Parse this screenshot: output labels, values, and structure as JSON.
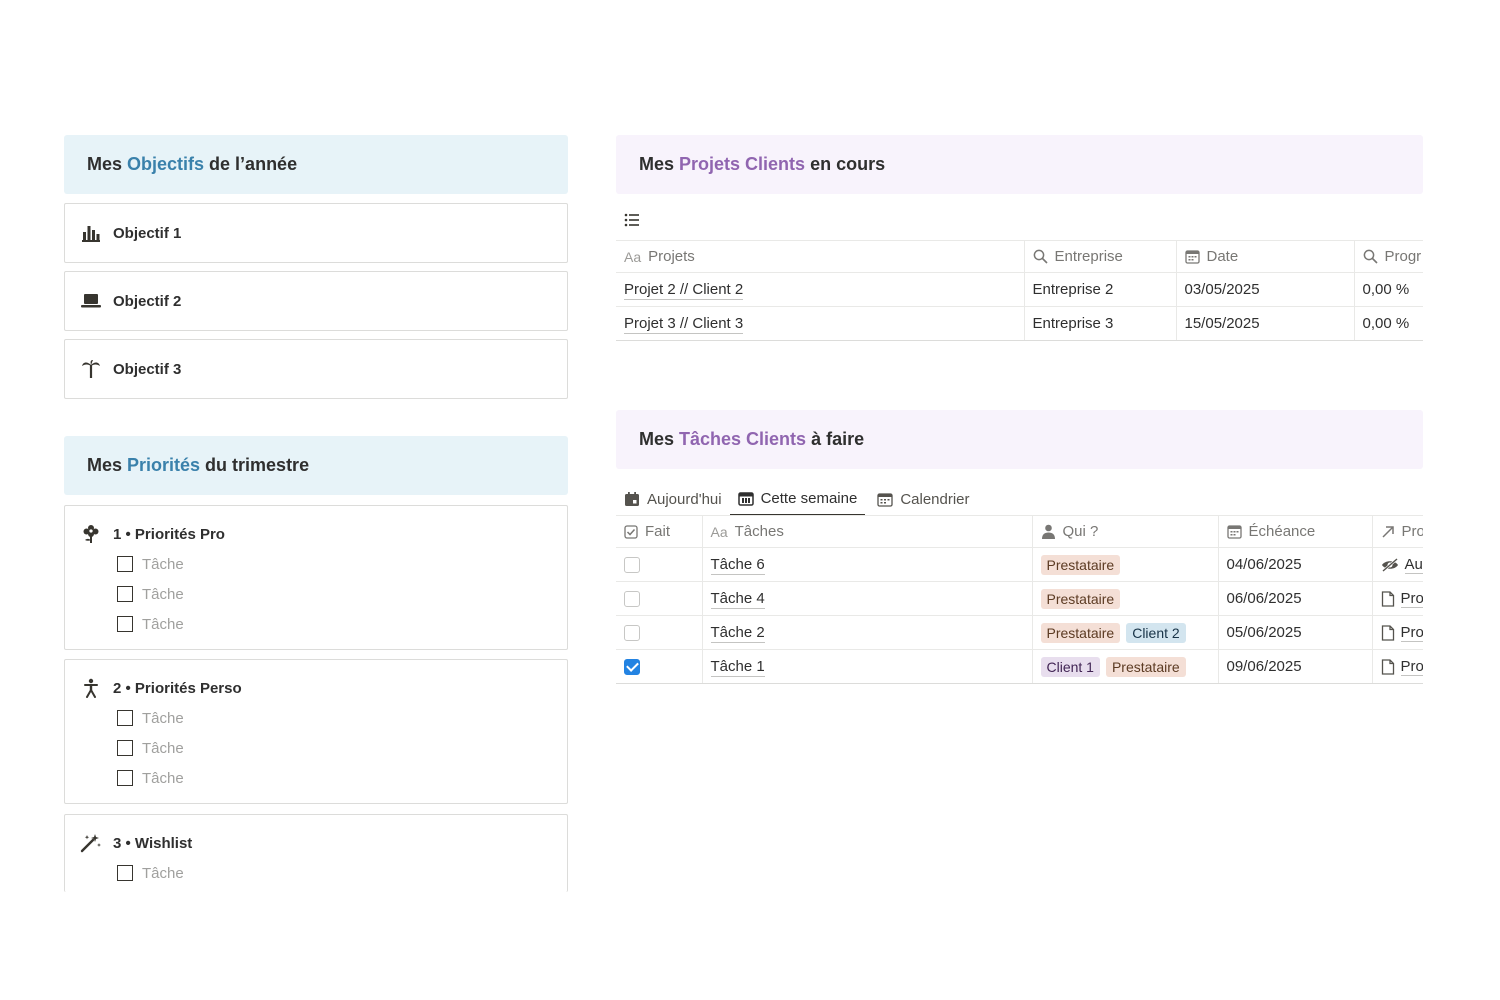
{
  "objectifs": {
    "title_pre": "Mes ",
    "title_hl": "Objectifs",
    "title_post": " de l’année",
    "items": [
      {
        "label": "Objectif 1",
        "icon": "bar-chart-icon"
      },
      {
        "label": "Objectif 2",
        "icon": "laptop-icon"
      },
      {
        "label": "Objectif 3",
        "icon": "palm-tree-icon"
      }
    ]
  },
  "priorites": {
    "title_pre": "Mes ",
    "title_hl": "Priorités",
    "title_post": " du trimestre",
    "groups": [
      {
        "label": "1 • Priorités Pro",
        "icon": "flower-icon",
        "todos": [
          "Tâche",
          "Tâche",
          "Tâche"
        ]
      },
      {
        "label": "2 • Priorités Perso",
        "icon": "person-icon",
        "todos": [
          "Tâche",
          "Tâche",
          "Tâche"
        ]
      },
      {
        "label": "3 • Wishlist",
        "icon": "magic-wand-icon",
        "todos": [
          "Tâche"
        ]
      }
    ]
  },
  "projets": {
    "title_pre": "Mes ",
    "title_hl": "Projets Clients",
    "title_post": " en cours",
    "view_icon": "list-icon",
    "columns": {
      "aa": "Aa",
      "projets": "Projets",
      "entreprise": "Entreprise",
      "date": "Date",
      "progression": "Progr"
    },
    "rows": [
      {
        "projet": "Projet 2 // Client 2",
        "entreprise": "Entreprise 2",
        "date": "03/05/2025",
        "progression": "0,00 %"
      },
      {
        "projet": "Projet 3 // Client 3",
        "entreprise": "Entreprise 3",
        "date": "15/05/2025",
        "progression": "0,00 %"
      }
    ]
  },
  "taches": {
    "title_pre": "Mes ",
    "title_hl": "Tâches Clients",
    "title_post": " à faire",
    "tabs": [
      {
        "label": "Aujourd'hui",
        "icon": "calendar-day-icon",
        "active": false
      },
      {
        "label": "Cette semaine",
        "icon": "calendar-week-icon",
        "active": true
      },
      {
        "label": "Calendrier",
        "icon": "calendar-icon",
        "active": false
      }
    ],
    "columns": {
      "fait": "Fait",
      "aa": "Aa",
      "taches": "Tâches",
      "qui": "Qui ?",
      "echeance": "Échéance",
      "projet": "Pro"
    },
    "rows": [
      {
        "done": false,
        "tache": "Tâche 6",
        "qui": [
          "Prestataire"
        ],
        "echeance": "04/06/2025",
        "projet": "Au",
        "projet_icon": "eye-off-icon"
      },
      {
        "done": false,
        "tache": "Tâche 4",
        "qui": [
          "Prestataire"
        ],
        "echeance": "06/06/2025",
        "projet": "Pro",
        "projet_icon": "page-icon"
      },
      {
        "done": false,
        "tache": "Tâche 2",
        "qui": [
          "Prestataire",
          "Client 2"
        ],
        "echeance": "05/06/2025",
        "projet": "Pro",
        "projet_icon": "page-icon"
      },
      {
        "done": true,
        "tache": "Tâche 1",
        "qui": [
          "Client 1",
          "Prestataire"
        ],
        "echeance": "09/06/2025",
        "projet": "Pro",
        "projet_icon": "page-icon"
      }
    ],
    "tag_colors": {
      "Prestataire": "brown",
      "Client 1": "purple",
      "Client 2": "blue"
    }
  }
}
